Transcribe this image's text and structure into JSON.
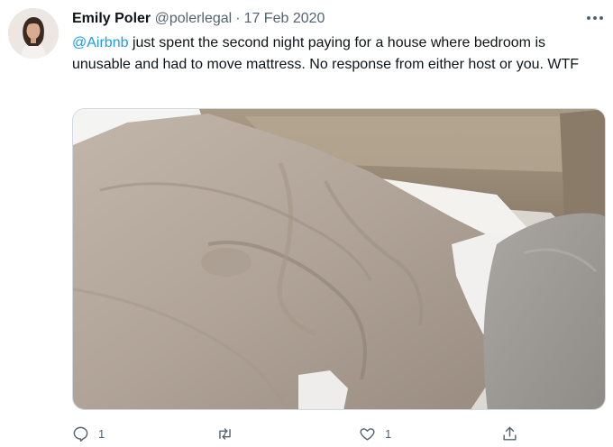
{
  "tweet": {
    "author_name": "Emily Poler",
    "author_handle": "@polerlegal",
    "separator": "·",
    "date": "17 Feb 2020",
    "mention": "@Airbnb",
    "body": " just spent the second night paying for a house where bedroom is unusable and had to move mattress. No response from either host or you. WTF"
  },
  "actions": {
    "reply_count": "1",
    "retweet_count": "",
    "like_count": "1"
  },
  "icons": {
    "more": "more-horizontal-icon",
    "reply": "reply-icon",
    "retweet": "retweet-icon",
    "like": "heart-icon",
    "share": "share-icon"
  },
  "colors": {
    "link": "#1d9bf0",
    "secondary_text": "#536471",
    "primary_text": "#0f1419"
  }
}
